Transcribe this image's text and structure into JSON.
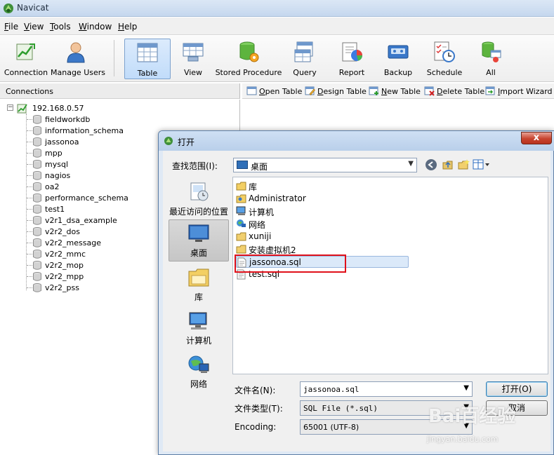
{
  "app": {
    "title": "Navicat"
  },
  "menu": [
    "File",
    "View",
    "Tools",
    "Window",
    "Help"
  ],
  "toolbar": [
    {
      "label": "Connection",
      "icon": "connection-icon"
    },
    {
      "label": "Manage Users",
      "icon": "user-icon"
    },
    {
      "label": "Table",
      "icon": "table-icon",
      "active": true
    },
    {
      "label": "View",
      "icon": "view-icon"
    },
    {
      "label": "Stored Procedure",
      "icon": "stored-procedure-icon"
    },
    {
      "label": "Query",
      "icon": "query-icon"
    },
    {
      "label": "Report",
      "icon": "report-icon"
    },
    {
      "label": "Backup",
      "icon": "backup-icon"
    },
    {
      "label": "Schedule",
      "icon": "schedule-icon"
    },
    {
      "label": "All",
      "icon": "all-objects-icon"
    }
  ],
  "connections": {
    "header": "Connections",
    "root": "192.168.0.57",
    "databases": [
      "fieldworkdb",
      "information_schema",
      "jassonoa",
      "mpp",
      "mysql",
      "nagios",
      "oa2",
      "performance_schema",
      "test1",
      "v2r1_dsa_example",
      "v2r2_dos",
      "v2r2_message",
      "v2r2_mmc",
      "v2r2_mop",
      "v2r2_mpp",
      "v2r2_pss"
    ]
  },
  "object_toolbar": [
    {
      "label": "Open Table",
      "icon": "open-table-icon"
    },
    {
      "label": "Design Table",
      "icon": "design-table-icon"
    },
    {
      "label": "New Table",
      "icon": "new-table-icon"
    },
    {
      "label": "Delete Table",
      "icon": "delete-table-icon"
    },
    {
      "label": "Import Wizard",
      "icon": "import-wizard-icon"
    }
  ],
  "dialog": {
    "title": "打开",
    "close": "x",
    "look_in_label": "查找范围(I):",
    "look_in_value": "桌面",
    "places": [
      {
        "label": "最近访问的位置",
        "icon": "recent-places-icon"
      },
      {
        "label": "桌面",
        "icon": "desktop-icon",
        "selected": true
      },
      {
        "label": "库",
        "icon": "libraries-icon"
      },
      {
        "label": "计算机",
        "icon": "computer-icon"
      },
      {
        "label": "网络",
        "icon": "network-icon"
      }
    ],
    "files": [
      {
        "name": "库",
        "icon": "libraries-icon"
      },
      {
        "name": "Administrator",
        "icon": "user-folder-icon"
      },
      {
        "name": "计算机",
        "icon": "computer-icon"
      },
      {
        "name": "网络",
        "icon": "network-icon"
      },
      {
        "name": "xuniji",
        "icon": "folder-icon"
      },
      {
        "name": "安装虚拟机2",
        "icon": "folder-icon"
      },
      {
        "name": "jassonoa.sql",
        "icon": "sql-file-icon",
        "selected": true
      },
      {
        "name": "test.sql",
        "icon": "sql-file-icon"
      }
    ],
    "filename_label": "文件名(N):",
    "filename_value": "jassonoa.sql",
    "filetype_label": "文件类型(T):",
    "filetype_value": "SQL File (*.sql)",
    "encoding_label": "Encoding:",
    "encoding_value": "65001 (UTF-8)",
    "open_button": "打开(O)",
    "cancel_button": "取消"
  },
  "watermark": {
    "text": "Bai百经验",
    "url": "jingyan.baidu.com"
  }
}
